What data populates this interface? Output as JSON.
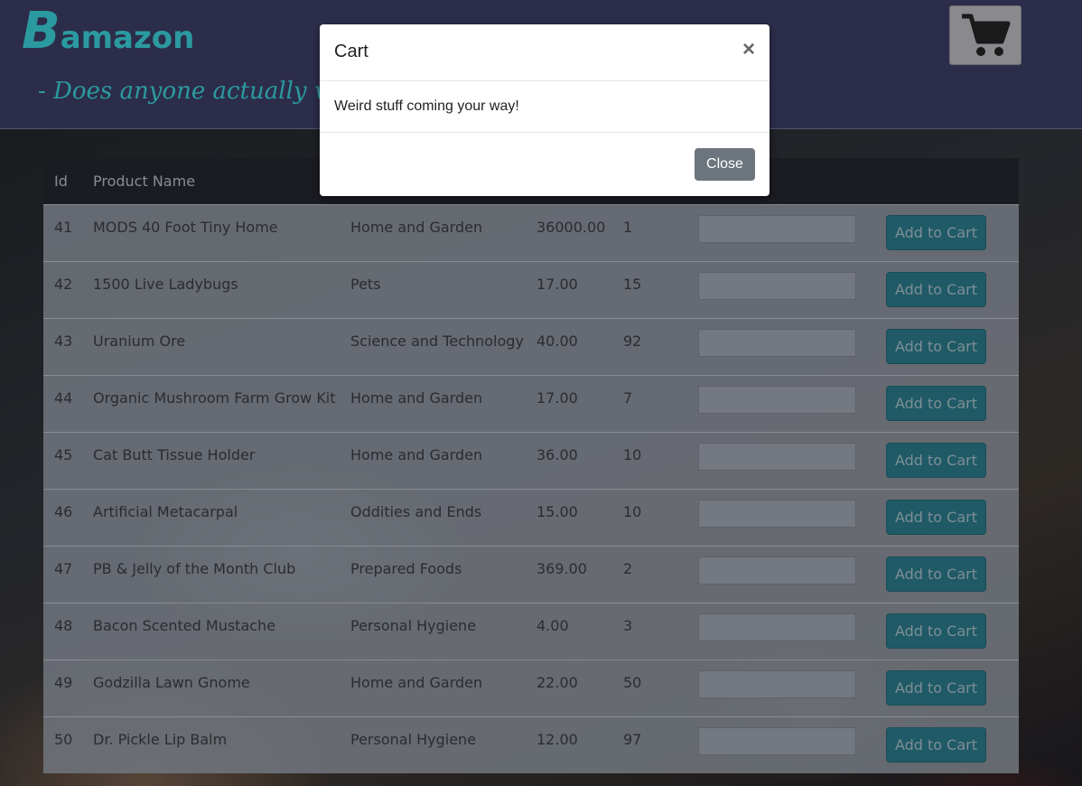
{
  "header": {
    "logo_initial": "B",
    "logo_rest": "amazon",
    "tagline": "- Does anyone actually want",
    "cart_icon": "shopping-cart-icon"
  },
  "table": {
    "columns": [
      "Id",
      "Product Name",
      "",
      "",
      "",
      "",
      ""
    ],
    "add_label": "Add to Cart",
    "rows": [
      {
        "id": "41",
        "name": "MODS 40 Foot Tiny Home",
        "department": "Home and Garden",
        "price": "36000.00",
        "stock": "1"
      },
      {
        "id": "42",
        "name": "1500 Live Ladybugs",
        "department": "Pets",
        "price": "17.00",
        "stock": "15"
      },
      {
        "id": "43",
        "name": "Uranium Ore",
        "department": "Science and Technology",
        "price": "40.00",
        "stock": "92"
      },
      {
        "id": "44",
        "name": "Organic Mushroom Farm Grow Kit",
        "department": "Home and Garden",
        "price": "17.00",
        "stock": "7"
      },
      {
        "id": "45",
        "name": "Cat Butt Tissue Holder",
        "department": "Home and Garden",
        "price": "36.00",
        "stock": "10"
      },
      {
        "id": "46",
        "name": "Artificial Metacarpal",
        "department": "Oddities and Ends",
        "price": "15.00",
        "stock": "10"
      },
      {
        "id": "47",
        "name": "PB & Jelly of the Month Club",
        "department": "Prepared Foods",
        "price": "369.00",
        "stock": "2"
      },
      {
        "id": "48",
        "name": "Bacon Scented Mustache",
        "department": "Personal Hygiene",
        "price": "4.00",
        "stock": "3"
      },
      {
        "id": "49",
        "name": "Godzilla Lawn Gnome",
        "department": "Home and Garden",
        "price": "22.00",
        "stock": "50"
      },
      {
        "id": "50",
        "name": "Dr. Pickle Lip Balm",
        "department": "Personal Hygiene",
        "price": "12.00",
        "stock": "97"
      }
    ]
  },
  "modal": {
    "title": "Cart",
    "close_symbol": "×",
    "body": "Weird stuff coming your way!",
    "close_label": "Close"
  },
  "colors": {
    "brand": "#2b9aa0",
    "header_bg": "#2c2d4a",
    "button_bg": "#1f5a66",
    "close_button_bg": "#6c757d"
  }
}
